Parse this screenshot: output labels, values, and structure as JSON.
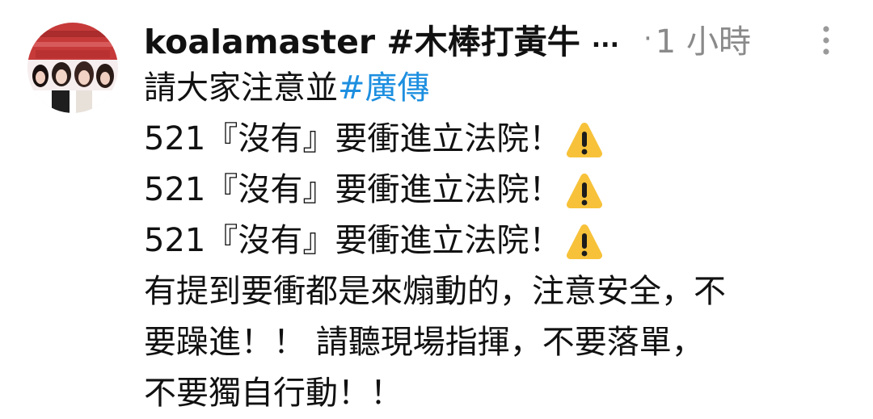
{
  "post": {
    "username": "koalamaster #木棒打黃牛",
    "username_truncation": "...",
    "time_separator": "·",
    "timestamp": "1 小時",
    "more_icon": "vertical-dots-icon",
    "warning_icon": "warning-icon",
    "hashtag_color": "#1d8fe0",
    "lines": [
      {
        "text": "請大家注意並 ",
        "hashtag": "#廣傳"
      },
      {
        "text": "521『沒有』要衝進立法院！"
      },
      {
        "text": "521『沒有』要衝進立法院！"
      },
      {
        "text": "521『沒有』要衝進立法院！"
      },
      {
        "text": "有提到要衝都是來煽動的，注意安全，不"
      },
      {
        "text": "要躁進！！ 請聽現場指揮，不要落單，"
      },
      {
        "text": "不要獨自行動！！"
      }
    ]
  }
}
